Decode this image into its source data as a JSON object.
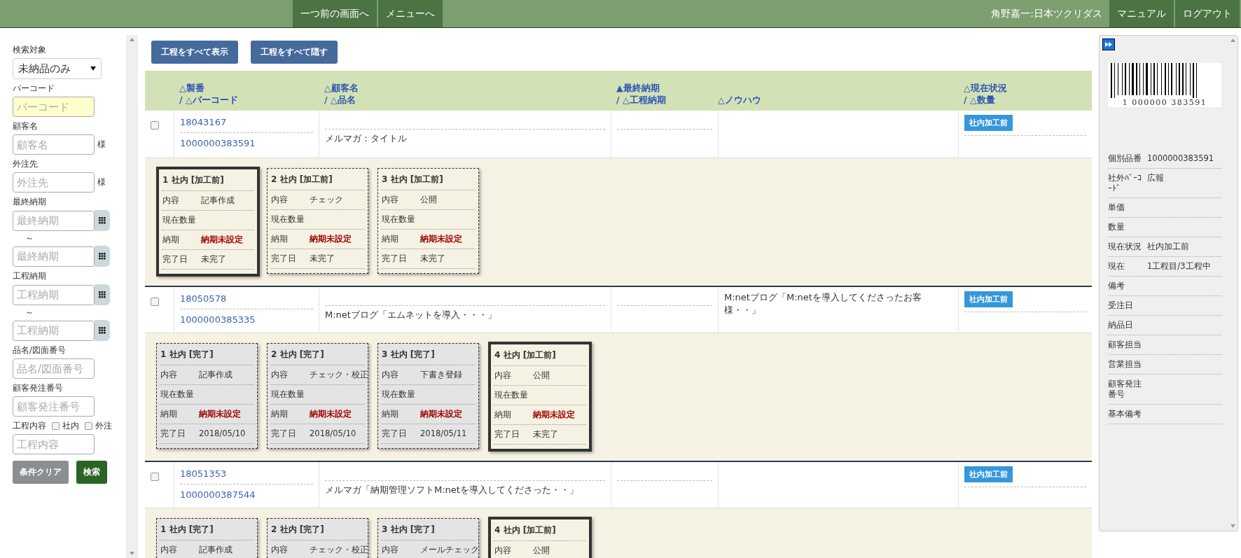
{
  "top_bar": {
    "nav": [
      "一つ前の画面へ",
      "メニューへ"
    ],
    "user": "角野嘉一:日本ツクリダス",
    "links": [
      "マニュアル",
      "ログアウト"
    ]
  },
  "sidebar": {
    "fields": [
      {
        "kind": "select",
        "label": "検索対象",
        "value": "未納品のみ"
      },
      {
        "kind": "highlight",
        "label": "バーコード",
        "placeholder": "バーコード"
      },
      {
        "kind": "suffix",
        "label": "顧客名",
        "placeholder": "顧客名",
        "suffix": "様"
      },
      {
        "kind": "suffix",
        "label": "外注先",
        "placeholder": "外注先",
        "suffix": "様"
      },
      {
        "kind": "range",
        "label": "最終納期",
        "inputs": [
          {
            "placeholder": "最終納期"
          },
          {
            "placeholder": "最終納期"
          }
        ],
        "separator": "～"
      },
      {
        "kind": "range",
        "label": "工程納期",
        "inputs": [
          {
            "placeholder": "工程納期"
          },
          {
            "placeholder": "工程納期"
          }
        ],
        "separator": "～"
      },
      {
        "kind": "text",
        "label": "品名/図面番号",
        "placeholder": "品名/図面番号"
      },
      {
        "kind": "text",
        "label": "顧客発注番号",
        "placeholder": "顧客発注番号"
      },
      {
        "kind": "checks",
        "label": "工程内容",
        "options": [
          {
            "label": "社内",
            "checked": false
          },
          {
            "label": "外注",
            "checked": false
          }
        ],
        "placeholder": "工程内容"
      }
    ],
    "buttons": [
      {
        "kind": "clear",
        "label": "条件クリア"
      },
      {
        "kind": "search",
        "label": "検索"
      }
    ]
  },
  "toolbar": [
    "工程をすべて表示",
    "工程をすべて隠す"
  ],
  "table": {
    "columns": [
      {
        "lines": [
          "△製番",
          "/ △バーコード"
        ]
      },
      {
        "lines": [
          "△顧客名",
          "/ △品名"
        ]
      },
      {
        "lines": [
          "▲最終納期",
          "/ △工程納期"
        ]
      },
      {
        "lines": [
          "△ノウハウ"
        ]
      },
      {
        "lines": [
          "△現在状況",
          "/ △数量"
        ]
      }
    ],
    "rows": [
      {
        "checked": false,
        "order_no": "18043167",
        "barcode": "1000000383591",
        "item": "メルマガ：タイトル",
        "status": "社内加工前",
        "processes": [
          {
            "title": "1 社内 [加工前]",
            "current": true,
            "done": false,
            "fields": [
              {
                "label": "内容",
                "value": "記事作成"
              },
              {
                "label": "現在数量"
              },
              {
                "label": "納期",
                "value": "納期未設定",
                "alert": true
              },
              {
                "label": "完了日",
                "value": "未完了"
              }
            ]
          },
          {
            "title": "2 社内 [加工前]",
            "current": false,
            "done": false,
            "fields": [
              {
                "label": "内容",
                "value": "チェック"
              },
              {
                "label": "現在数量"
              },
              {
                "label": "納期",
                "value": "納期未設定",
                "alert": true
              },
              {
                "label": "完了日",
                "value": "未完了"
              }
            ]
          },
          {
            "title": "3 社内 [加工前]",
            "current": false,
            "done": false,
            "fields": [
              {
                "label": "内容",
                "value": "公開"
              },
              {
                "label": "現在数量"
              },
              {
                "label": "納期",
                "value": "納期未設定",
                "alert": true
              },
              {
                "label": "完了日",
                "value": "未完了"
              }
            ]
          }
        ]
      },
      {
        "checked": false,
        "order_no": "18050578",
        "barcode": "1000000385335",
        "item": "M:netブログ「エムネットを導入・・・」",
        "knowhow": "M:netブログ「M:netを導入してくださったお客様・・」",
        "status": "社内加工前",
        "processes": [
          {
            "title": "1 社内 [完了]",
            "current": false,
            "done": true,
            "fields": [
              {
                "label": "内容",
                "value": "記事作成"
              },
              {
                "label": "現在数量"
              },
              {
                "label": "納期",
                "value": "納期未設定",
                "alert": true
              },
              {
                "label": "完了日",
                "value": "2018/05/10"
              }
            ]
          },
          {
            "title": "2 社内 [完了]",
            "current": false,
            "done": true,
            "fields": [
              {
                "label": "内容",
                "value": "チェック・校正"
              },
              {
                "label": "現在数量"
              },
              {
                "label": "納期",
                "value": "納期未設定",
                "alert": true
              },
              {
                "label": "完了日",
                "value": "2018/05/10"
              }
            ]
          },
          {
            "title": "3 社内 [完了]",
            "current": false,
            "done": true,
            "fields": [
              {
                "label": "内容",
                "value": "下書き登録"
              },
              {
                "label": "現在数量"
              },
              {
                "label": "納期",
                "value": "納期未設定",
                "alert": true
              },
              {
                "label": "完了日",
                "value": "2018/05/11"
              }
            ]
          },
          {
            "title": "4 社内 [加工前]",
            "current": true,
            "done": false,
            "fields": [
              {
                "label": "内容",
                "value": "公開"
              },
              {
                "label": "現在数量"
              },
              {
                "label": "納期",
                "value": "納期未設定",
                "alert": true
              },
              {
                "label": "完了日",
                "value": "未完了"
              }
            ]
          }
        ]
      },
      {
        "checked": false,
        "order_no": "18051353",
        "barcode": "1000000387544",
        "item": "メルマガ「納期管理ソフトM:netを導入してくださった・・」",
        "status": "社内加工前",
        "processes": [
          {
            "title": "1 社内 [完了]",
            "current": false,
            "done": true,
            "fields": [
              {
                "label": "内容",
                "value": "記事作成"
              }
            ]
          },
          {
            "title": "2 社内 [完了]",
            "current": false,
            "done": true,
            "fields": [
              {
                "label": "内容",
                "value": "チェック・校正"
              }
            ]
          },
          {
            "title": "3 社内 [完了]",
            "current": false,
            "done": true,
            "fields": [
              {
                "label": "内容",
                "value": "メールチェック"
              }
            ]
          },
          {
            "title": "4 社内 [加工前]",
            "current": true,
            "done": false,
            "fields": [
              {
                "label": "内容",
                "value": "公開"
              }
            ]
          }
        ]
      }
    ]
  },
  "detail_panel": {
    "barcode_digits": "1 000000 383591",
    "rows": [
      {
        "label": "個別品番",
        "value": "1000000383591"
      },
      {
        "label": "社外ﾊﾞｰｺｰﾄﾞ",
        "value": "広報"
      },
      {
        "label": "単価"
      },
      {
        "label": "数量"
      },
      {
        "label": "現在状況",
        "value": "社内加工前"
      },
      {
        "label": "現在",
        "value": "1工程目/3工程中"
      },
      {
        "label": "備考"
      },
      {
        "label": "受注日"
      },
      {
        "label": "納品日"
      },
      {
        "label": "顧客担当"
      },
      {
        "label": "営業担当"
      },
      {
        "label": "顧客発注番号"
      },
      {
        "label": "基本備考"
      }
    ]
  }
}
